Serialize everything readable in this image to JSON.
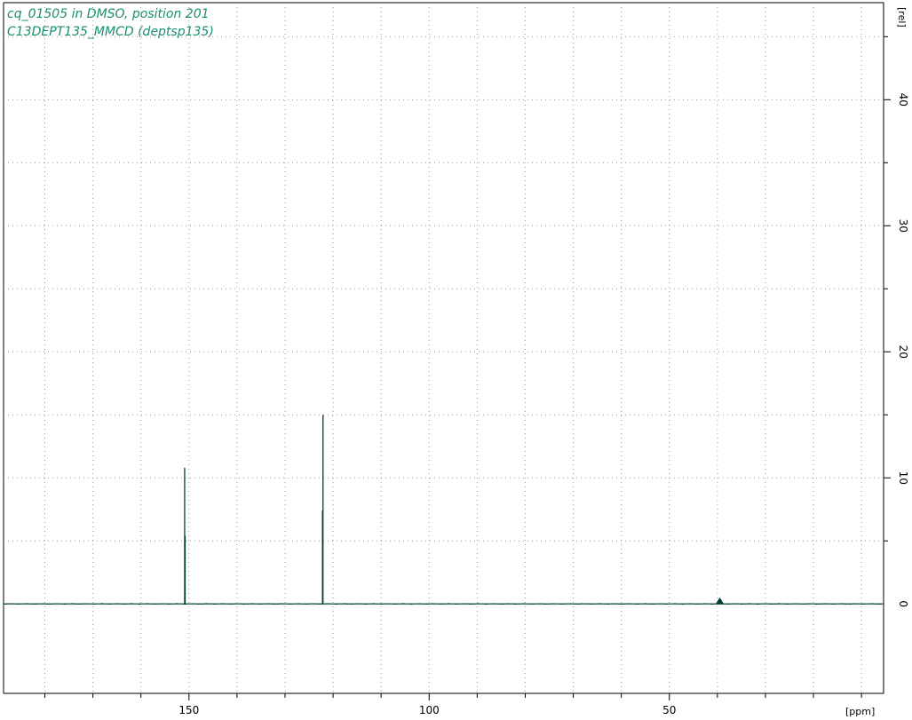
{
  "chart_data": {
    "type": "line",
    "title_lines": [
      "cq_01505 in DMSO, position 201",
      "C13DEPT135_MMCD (deptsp135)"
    ],
    "xlabel": "[ppm]",
    "ylabel": "[rel]",
    "x_reversed": true,
    "xlim": [
      188.6,
      5.4
    ],
    "ylim": [
      -7.1,
      47.7
    ],
    "x_ticks": [
      150,
      100,
      50
    ],
    "y_ticks": [
      0,
      10,
      20,
      30,
      40
    ],
    "grid": true,
    "colors": {
      "title": "#1a8f6f",
      "trace": "#003d35",
      "grid": "#9a9a9a",
      "axis": "#000000"
    },
    "peaks": [
      {
        "ppm": 150.9,
        "intensity": 10.8
      },
      {
        "ppm": 150.8,
        "intensity": 5.4
      },
      {
        "ppm": 122.1,
        "intensity": 15.0
      },
      {
        "ppm": 122.2,
        "intensity": 7.4
      },
      {
        "ppm": 39.5,
        "intensity": 0.3
      }
    ]
  }
}
